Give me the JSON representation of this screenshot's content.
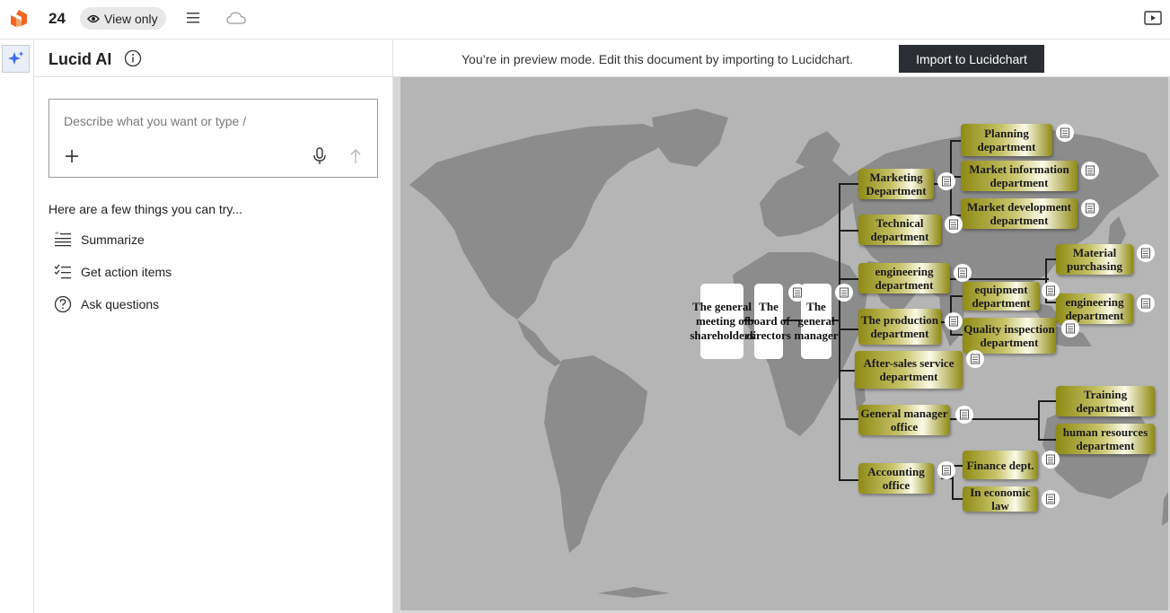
{
  "topbar": {
    "page_number": "24",
    "view_mode_label": "View only",
    "icons": [
      "lucid-logo-icon",
      "eye-icon",
      "hamburger-menu-icon",
      "cloud-icon",
      "present-icon"
    ]
  },
  "ai_panel": {
    "title": "Lucid AI",
    "prompt_placeholder": "Describe what you want or type /",
    "try_heading": "Here are a few things you can try...",
    "suggestions": [
      {
        "label": "Summarize",
        "icon": "summarize-icon"
      },
      {
        "label": "Get action items",
        "icon": "checklist-icon"
      },
      {
        "label": "Ask questions",
        "icon": "question-circle-icon"
      }
    ]
  },
  "preview": {
    "message": "You’re in preview mode. Edit this document by importing to Lucidchart.",
    "import_button_label": "Import to Lucidchart"
  },
  "org_chart": {
    "root_boxes": [
      "The general meeting of shareholders",
      "The board of directors",
      "The general manager"
    ],
    "departments": [
      "Marketing Department",
      "Technical department",
      "engineering department",
      "The production department",
      "After-sales service department",
      "General manager office",
      "Accounting office"
    ],
    "sub_departments": [
      "Planning department",
      "Market information department",
      "Market development department",
      "Material purchasing",
      "engineering department",
      "equipment department",
      "Quality inspection department",
      "Training department",
      "human resources department",
      "Finance dept.",
      "In economic law"
    ]
  },
  "colors": {
    "accent": "#3b6ee8",
    "logo": "#f26522",
    "map_land": "#8c8c8c",
    "map_sea": "#b5b5b5",
    "dept_gold": "#8e8a14",
    "import_button": "#2a2d32"
  }
}
